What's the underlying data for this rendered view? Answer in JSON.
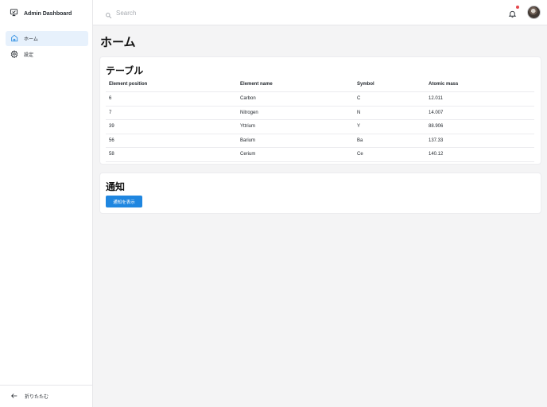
{
  "app": {
    "title": "Admin Dashboard"
  },
  "sidebar": {
    "items": [
      {
        "label": "ホーム",
        "icon": "home-icon",
        "active": true
      },
      {
        "label": "設定",
        "icon": "gear-icon",
        "active": false
      }
    ],
    "collapse_label": "折りたたむ"
  },
  "search": {
    "placeholder": "Search",
    "value": ""
  },
  "header": {
    "notification_badge_color": "#e5484d"
  },
  "page": {
    "title": "ホーム"
  },
  "table_card": {
    "title": "テーブル",
    "columns": [
      "Element position",
      "Element name",
      "Symbol",
      "Atomic mass"
    ],
    "rows": [
      [
        "6",
        "Carbon",
        "C",
        "12.011"
      ],
      [
        "7",
        "Nitrogen",
        "N",
        "14.007"
      ],
      [
        "39",
        "Yttrium",
        "Y",
        "88.906"
      ],
      [
        "56",
        "Barium",
        "Ba",
        "137.33"
      ],
      [
        "58",
        "Cerium",
        "Ce",
        "140.12"
      ]
    ]
  },
  "notify_card": {
    "title": "通知",
    "button_label": "通知を表示"
  },
  "colors": {
    "accent": "#1f86e0",
    "active_nav_bg": "#e7f1fc"
  }
}
